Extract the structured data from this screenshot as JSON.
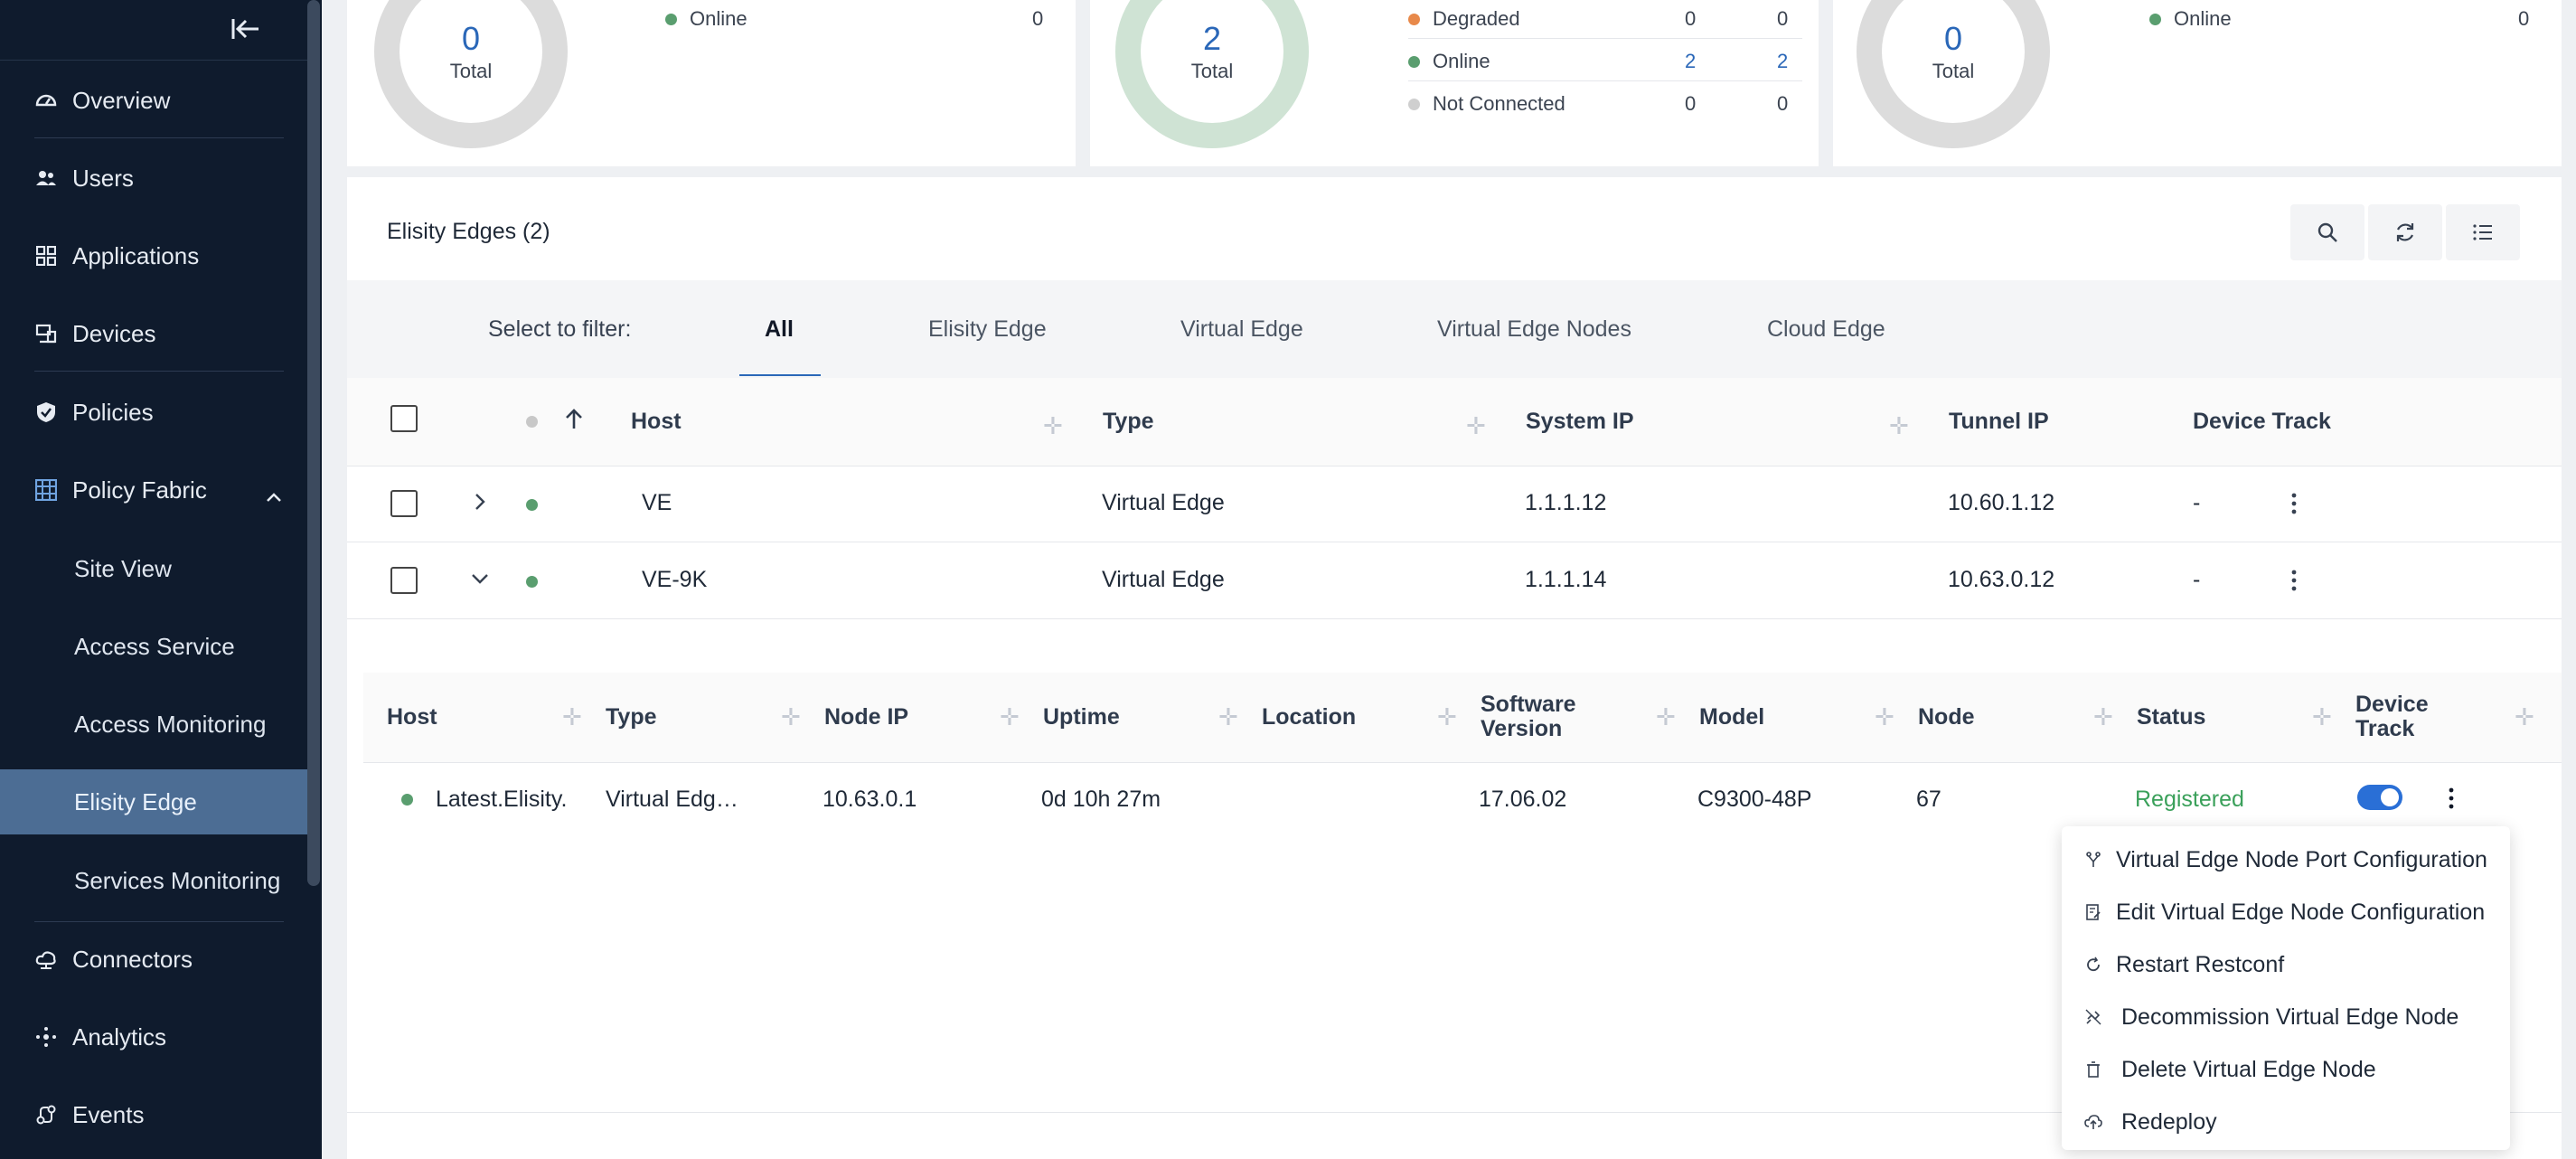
{
  "colors": {
    "sidebar_bg": "#0f1b2d",
    "active_item": "#4c6d94",
    "accent": "#2a67b8",
    "online": "#5a9e6f",
    "degraded": "#e8894a",
    "not_connected": "#cfcfcf",
    "registered": "#3aa05a"
  },
  "sidebar": {
    "collapse_icon": "collapse-left-icon",
    "items": [
      {
        "label": "Overview",
        "icon": "dashboard-icon"
      },
      {
        "label": "Users",
        "icon": "users-icon"
      },
      {
        "label": "Applications",
        "icon": "apps-grid-icon"
      },
      {
        "label": "Devices",
        "icon": "devices-icon"
      },
      {
        "label": "Policies",
        "icon": "shield-icon"
      },
      {
        "label": "Policy Fabric",
        "icon": "fabric-grid-icon",
        "expanded": true
      },
      {
        "label": "Connectors",
        "icon": "cloud-icon"
      },
      {
        "label": "Analytics",
        "icon": "analytics-icon"
      },
      {
        "label": "Events",
        "icon": "events-icon"
      }
    ],
    "subitems": [
      {
        "label": "Site View"
      },
      {
        "label": "Access Service"
      },
      {
        "label": "Access Monitoring"
      },
      {
        "label": "Elisity Edge",
        "active": true
      },
      {
        "label": "Services Monitoring"
      }
    ]
  },
  "cards": [
    {
      "total": "0",
      "total_label": "Total",
      "legend": [
        {
          "label": "Online",
          "values": [
            "0"
          ],
          "color": "#5a9e6f"
        }
      ]
    },
    {
      "total": "2",
      "total_label": "Total",
      "legend": [
        {
          "label": "Degraded",
          "values": [
            "0",
            "0"
          ],
          "color": "#e8894a"
        },
        {
          "label": "Online",
          "values": [
            "2",
            "2"
          ],
          "color": "#5a9e6f"
        },
        {
          "label": "Not Connected",
          "values": [
            "0",
            "0"
          ],
          "color": "#cfcfcf"
        }
      ]
    },
    {
      "total": "0",
      "total_label": "Total",
      "legend": [
        {
          "label": "Online",
          "values": [
            "0"
          ],
          "color": "#5a9e6f"
        }
      ]
    }
  ],
  "panel": {
    "title": "Elisity Edges (2)",
    "tools": [
      {
        "icon": "search-icon"
      },
      {
        "icon": "refresh-icon"
      },
      {
        "icon": "list-icon"
      }
    ],
    "filter_label": "Select to filter:",
    "filters": [
      "All",
      "Elisity Edge",
      "Virtual Edge",
      "Virtual Edge Nodes",
      "Cloud Edge"
    ],
    "active_filter": "All",
    "columns": [
      "Host",
      "Type",
      "System IP",
      "Tunnel IP",
      "Device Track"
    ],
    "rows": [
      {
        "host": "VE",
        "type": "Virtual Edge",
        "system_ip": "1.1.1.12",
        "tunnel_ip": "10.60.1.12",
        "device_track": "-",
        "expanded": false
      },
      {
        "host": "VE-9K",
        "type": "Virtual Edge",
        "system_ip": "1.1.1.14",
        "tunnel_ip": "10.63.0.12",
        "device_track": "-",
        "expanded": true
      }
    ],
    "subtable": {
      "columns": [
        "Host",
        "Type",
        "Node IP",
        "Uptime",
        "Location",
        "Software Version",
        "Model",
        "Node",
        "Status",
        "Device Track"
      ],
      "row": {
        "host": "Latest.Elisity.",
        "type": "Virtual Edg…",
        "node_ip": "10.63.0.1",
        "uptime": "0d 10h 27m",
        "location": "",
        "software_version": "17.06.02",
        "model": "C9300-48P",
        "node": "67",
        "status": "Registered",
        "device_track_on": true
      }
    }
  },
  "context_menu": {
    "items": [
      {
        "label": "Virtual Edge Node Port Configuration",
        "icon": "port-config-icon"
      },
      {
        "label": "Edit Virtual Edge Node Configuration",
        "icon": "edit-config-icon"
      },
      {
        "label": "Restart Restconf",
        "icon": "restart-icon"
      },
      {
        "label": "Decommission Virtual Edge Node",
        "icon": "decommission-icon"
      },
      {
        "label": "Delete Virtual Edge Node",
        "icon": "trash-icon"
      },
      {
        "label": "Redeploy",
        "icon": "cloud-upload-icon"
      }
    ]
  }
}
